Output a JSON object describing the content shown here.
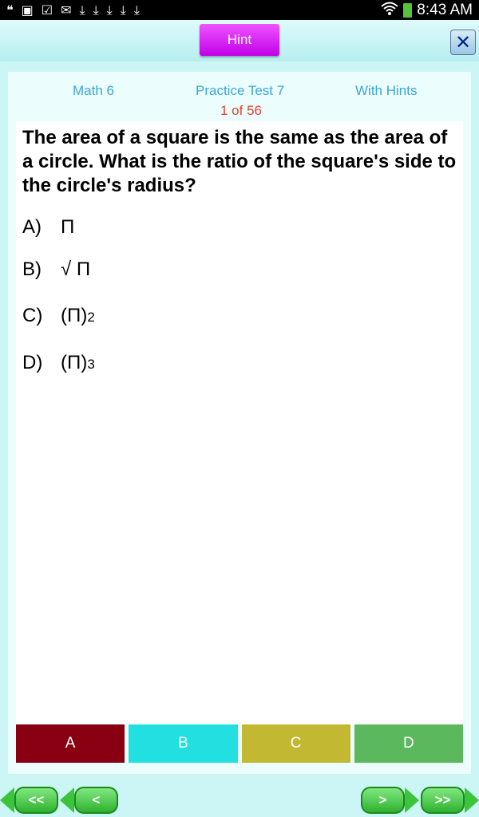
{
  "status_bar": {
    "time": "8:43 AM",
    "icons": [
      "hangouts-icon",
      "gallery-icon",
      "task-check-icon",
      "email-icon",
      "download-icon",
      "download-icon",
      "download-icon",
      "download-icon",
      "download-icon",
      "wifi-icon",
      "battery-icon"
    ]
  },
  "header": {
    "hint_label": "Hint",
    "close_icon": "close-icon"
  },
  "meta": {
    "subject": "Math 6",
    "test": "Practice Test 7",
    "mode": "With Hints",
    "counter": "1 of 56"
  },
  "question": {
    "text": "The area of a square is the same as the area of a circle. What is the ratio of the square's side to the circle's radius?",
    "choices": [
      {
        "letter": "A)",
        "value": "Π",
        "exp": ""
      },
      {
        "letter": "B)",
        "value": "√ Π",
        "exp": ""
      },
      {
        "letter": "C)",
        "value": "(Π)",
        "exp": "2"
      },
      {
        "letter": "D)",
        "value": "(Π)",
        "exp": "3"
      }
    ]
  },
  "answer_buttons": [
    {
      "label": "A",
      "color": "#880011"
    },
    {
      "label": "B",
      "color": "#22e0e0"
    },
    {
      "label": "C",
      "color": "#c3b832"
    },
    {
      "label": "D",
      "color": "#5cb85c"
    }
  ],
  "nav": {
    "first": "<<",
    "prev": "<",
    "next": ">",
    "last": ">>"
  }
}
